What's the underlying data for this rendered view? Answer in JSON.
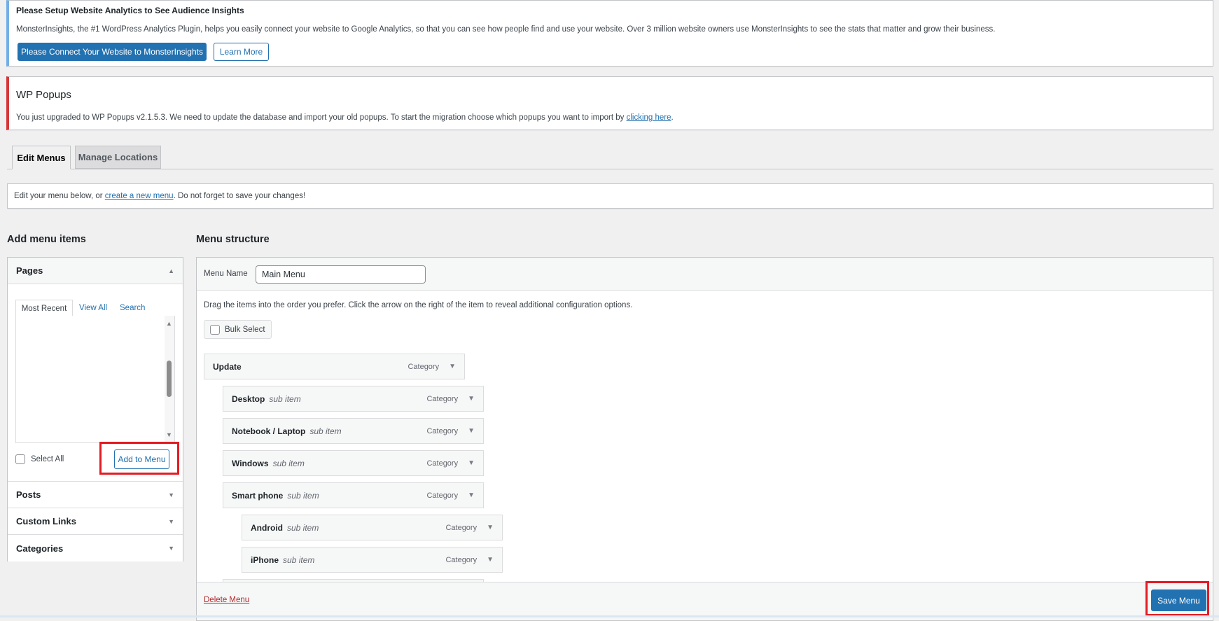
{
  "analytics_notice": {
    "title": "Please Setup Website Analytics to See Audience Insights",
    "body": "MonsterInsights, the #1 WordPress Analytics Plugin, helps you easily connect your website to Google Analytics, so that you can see how people find and use your website. Over 3 million website owners use MonsterInsights to see the stats that matter and grow their business.",
    "connect_button": "Please Connect Your Website to MonsterInsights",
    "learn_more_button": "Learn More"
  },
  "popups_notice": {
    "title": "WP Popups",
    "body": "You just upgraded to WP Popups v2.1.5.3. We need to update the database and import your old popups. To start the migration choose which popups you want to import by ",
    "link": "clicking here",
    "end": "."
  },
  "tabs": [
    {
      "label": "Edit Menus",
      "active": true
    },
    {
      "label": "Manage Locations",
      "active": false
    }
  ],
  "edit_notice": {
    "before": "Edit your menu below, or ",
    "link": "create a new menu",
    "after": ". Do not forget to save your changes!"
  },
  "add_items": {
    "heading": "Add menu items",
    "pages": {
      "label": "Pages",
      "tabs": [
        "Most Recent",
        "View All",
        "Search"
      ],
      "select_all": "Select All",
      "add_button": "Add to Menu"
    },
    "sections": [
      "Posts",
      "Custom Links",
      "Categories"
    ]
  },
  "menu_structure": {
    "heading": "Menu structure",
    "menu_name_label": "Menu Name",
    "menu_name_value": "Main Menu",
    "instructions": "Drag the items into the order you prefer. Click the arrow on the right of the item to reveal additional configuration options.",
    "bulk_select": "Bulk Select",
    "items": [
      {
        "title": "Update",
        "sub": "",
        "type": "Category",
        "depth": 0
      },
      {
        "title": "Desktop",
        "sub": "sub item",
        "type": "Category",
        "depth": 1
      },
      {
        "title": "Notebook / Laptop",
        "sub": "sub item",
        "type": "Category",
        "depth": 1
      },
      {
        "title": "Windows",
        "sub": "sub item",
        "type": "Category",
        "depth": 1
      },
      {
        "title": "Smart phone",
        "sub": "sub item",
        "type": "Category",
        "depth": 1
      },
      {
        "title": "Android",
        "sub": "sub item",
        "type": "Category",
        "depth": 2
      },
      {
        "title": "iPhone",
        "sub": "sub item",
        "type": "Category",
        "depth": 2
      }
    ],
    "delete_link": "Delete Menu",
    "save_button": "Save Menu"
  },
  "colors": {
    "accent": "#2271b1",
    "highlight": "#e31b23",
    "info_border": "#72aee6",
    "error_border": "#d63638"
  }
}
